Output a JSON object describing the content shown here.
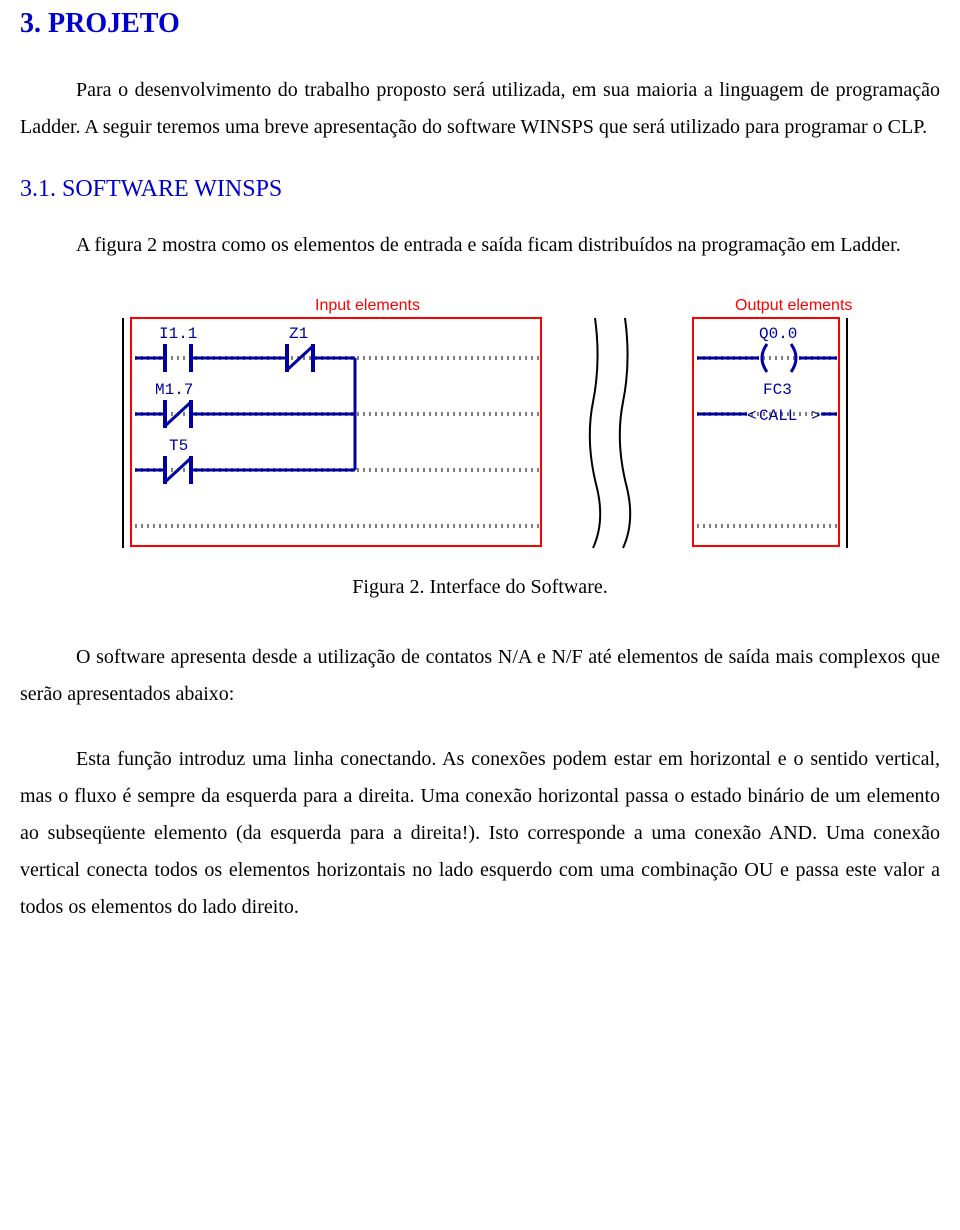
{
  "heading1": "3. PROJETO",
  "para1": "Para o desenvolvimento do trabalho proposto será utilizada, em sua maioria a linguagem de programação Ladder. A seguir teremos uma breve apresentação do software WINSPS que será utilizado para programar o CLP.",
  "heading2": "3.1. SOFTWARE WINSPS",
  "para2": "A figura 2 mostra como os elementos de entrada e saída ficam distribuídos na programação em Ladder.",
  "figure": {
    "label_input": "Input elements",
    "label_output": "Output elements",
    "contacts": {
      "i11": "I1.1",
      "z1": "Z1",
      "m17": "M1.7",
      "t5": "T5"
    },
    "outputs": {
      "q00": "Q0.0",
      "fc3": "FC3",
      "call": "CALL"
    }
  },
  "caption": "Figura 2. Interface do Software.",
  "para3": "O software apresenta desde a utilização de contatos N/A  e N/F até elementos de saída mais complexos que serão apresentados abaixo:",
  "para4": "Esta função introduz uma linha conectando. As conexões podem estar em horizontal e o sentido vertical, mas o fluxo é sempre da esquerda para a direita. Uma conexão horizontal passa o estado binário de um elemento ao subseqüente elemento (da esquerda para a direita!). Isto corresponde a uma conexão AND. Uma conexão vertical conecta todos os elementos horizontais no lado esquerdo com uma combinação OU e passa este valor a todos os elementos do lado direito."
}
